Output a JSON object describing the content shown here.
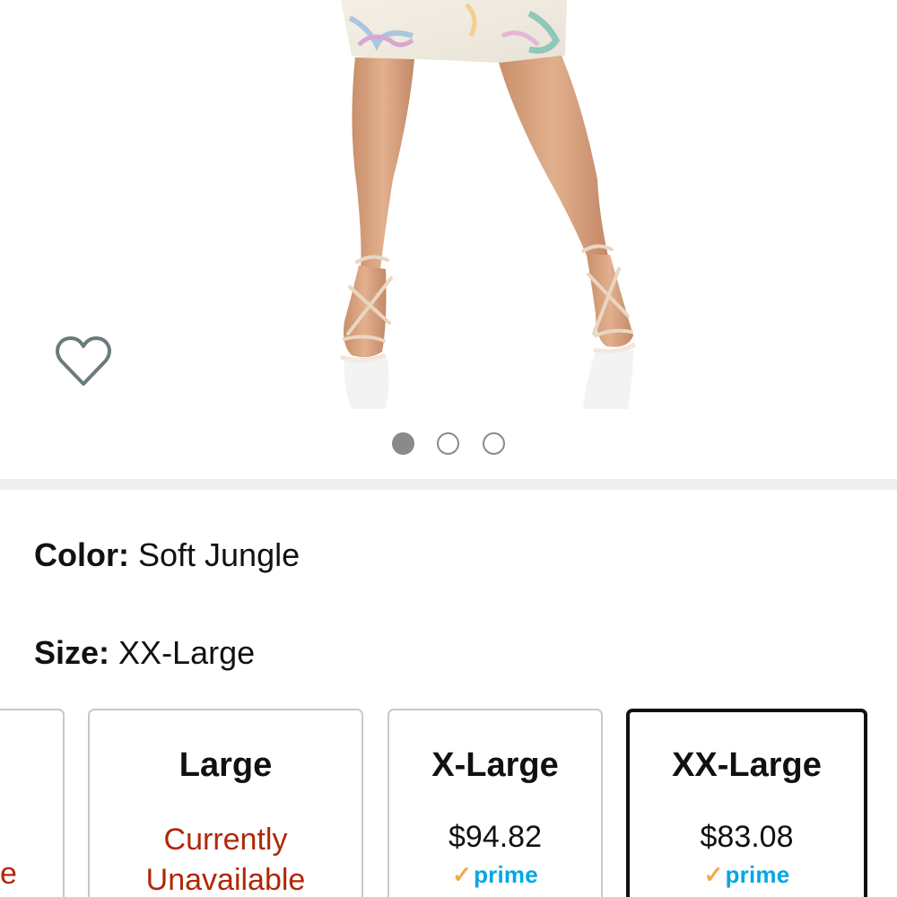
{
  "gallery": {
    "image_alt": "Model wearing printed dress with strappy nude sandals",
    "dots": [
      {
        "active": true
      },
      {
        "active": false
      },
      {
        "active": false
      }
    ]
  },
  "icons": {
    "wishlist": "heart-outline-icon"
  },
  "variations": {
    "color_label": "Color:",
    "color_value": "Soft Jungle",
    "size_label": "Size:",
    "size_value": "XX-Large"
  },
  "sizes": [
    {
      "name": "",
      "status": "e"
    },
    {
      "name": "Large",
      "status_line1": "Currently",
      "status_line2": "Unavailable"
    },
    {
      "name": "X-Large",
      "price": "$94.82",
      "prime": "prime"
    },
    {
      "name": "XX-Large",
      "price": "$83.08",
      "prime": "prime",
      "selected": true
    }
  ],
  "colors": {
    "unavailable": "#b12704",
    "prime_blue": "#00a8e1",
    "prime_check": "#f3a847",
    "selected_border": "#111111",
    "tile_border": "#c8c8c8",
    "divider": "#eeeeee"
  }
}
